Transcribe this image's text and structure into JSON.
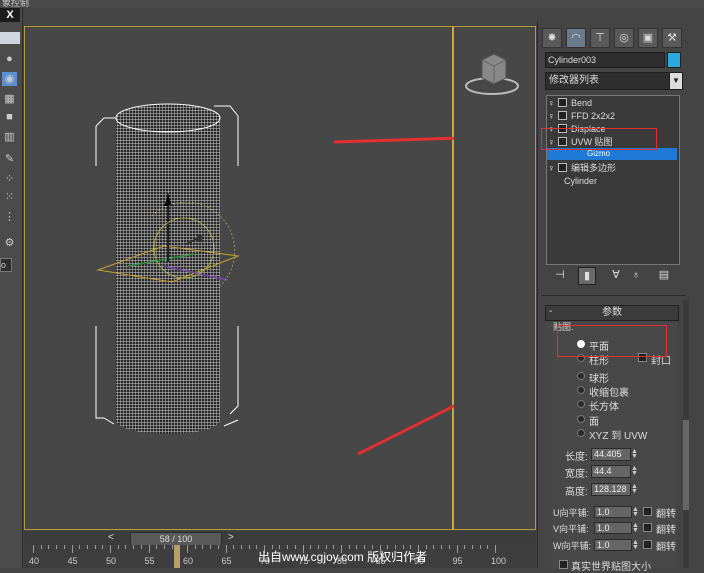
{
  "window": {
    "title_fragment": "象控制"
  },
  "left_toolbar": {
    "close_label": "X"
  },
  "timeline": {
    "frame_label": "58 / 100",
    "prev_label": "<",
    "next_label": ">",
    "current_frame": 58,
    "total_frames": 100
  },
  "ruler": {
    "labels": [
      "40",
      "45",
      "50",
      "55",
      "60",
      "65",
      "70",
      "75",
      "80",
      "85",
      "90",
      "95",
      "100"
    ]
  },
  "watermark": "出自www.cgjoy.com 版权归作者",
  "command_panel": {
    "object_name": "Cylinder003",
    "object_color": "#2aa8e0",
    "modifier_list_label": "修改器列表",
    "stack": [
      {
        "label": "Bend"
      },
      {
        "label": "FFD 2x2x2"
      },
      {
        "label": "Displace"
      },
      {
        "label": "UVW 贴图"
      },
      {
        "label": "Gizmo"
      },
      {
        "label": "编辑多边形"
      },
      {
        "label": "Cylinder"
      }
    ],
    "rollout_title": "参数",
    "rollout_minus": "-",
    "mapping_label": "贴图:",
    "mapping_options": [
      {
        "label": "平面",
        "selected": true
      },
      {
        "label": "柱形",
        "selected": false
      },
      {
        "label": "球形",
        "selected": false
      },
      {
        "label": "收缩包裹",
        "selected": false
      },
      {
        "label": "长方体",
        "selected": false
      },
      {
        "label": "面",
        "selected": false
      },
      {
        "label": "XYZ 到 UVW",
        "selected": false
      }
    ],
    "cap_label": "封口",
    "length": {
      "label": "长度:",
      "value": "44.405"
    },
    "width": {
      "label": "宽度:",
      "value": "44.4"
    },
    "height": {
      "label": "高度:",
      "value": "128.128"
    },
    "tiling": [
      {
        "label": "U向平铺:",
        "value": "1.0",
        "flip": "翻转"
      },
      {
        "label": "V向平铺:",
        "value": "1.0",
        "flip": "翻转"
      },
      {
        "label": "W向平铺:",
        "value": "1.0",
        "flip": "翻转"
      }
    ],
    "real_world_label": "真实世界贴图大小"
  },
  "colors": {
    "highlight_red": "#e03030",
    "selection_blue": "#1e7ad6",
    "viewport_border": "#b89a3a"
  }
}
